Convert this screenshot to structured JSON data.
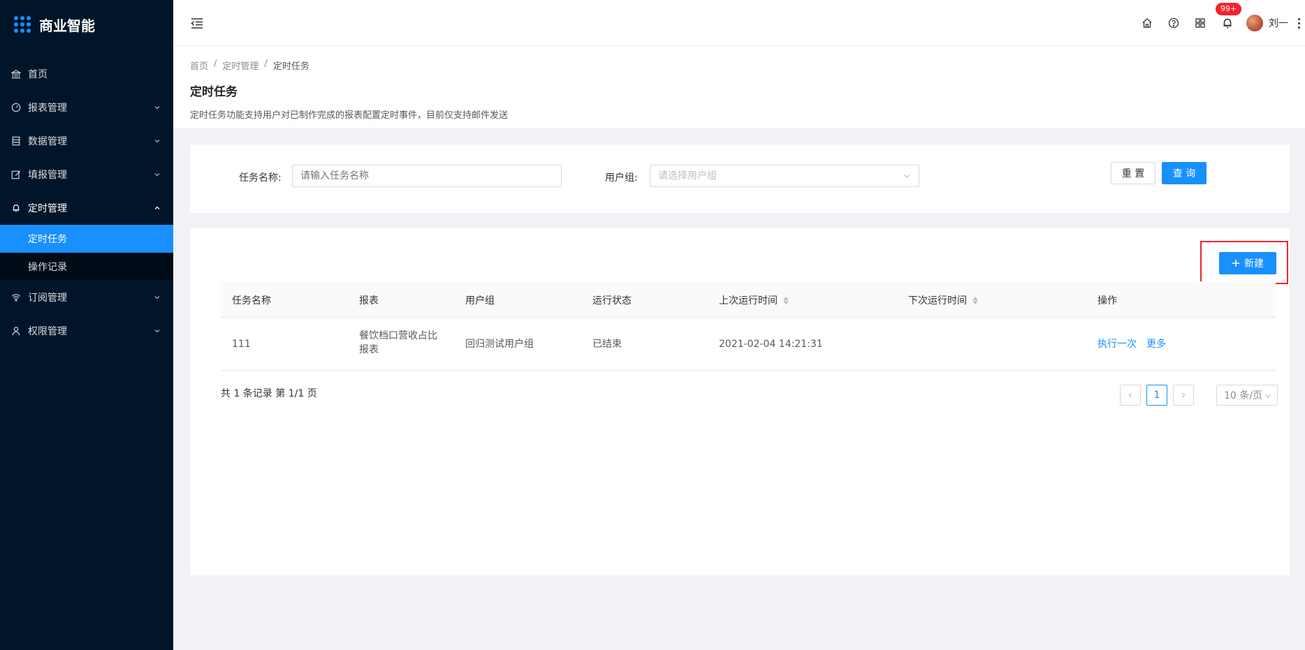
{
  "app": {
    "title": "商业智能"
  },
  "sidebar": {
    "items": [
      {
        "label": "首页",
        "icon": "bank-icon"
      },
      {
        "label": "报表管理",
        "icon": "dashboard-icon"
      },
      {
        "label": "数据管理",
        "icon": "database-icon"
      },
      {
        "label": "填报管理",
        "icon": "edit-icon"
      },
      {
        "label": "定时管理",
        "icon": "bell-icon",
        "expanded": true,
        "children": [
          {
            "label": "定时任务",
            "selected": true
          },
          {
            "label": "操作记录"
          }
        ]
      },
      {
        "label": "订阅管理",
        "icon": "wifi-icon"
      },
      {
        "label": "权限管理",
        "icon": "user-icon"
      }
    ]
  },
  "header": {
    "badge": "99+",
    "user_name": "刘一"
  },
  "breadcrumb": [
    "首页",
    "定时管理",
    "定时任务"
  ],
  "page": {
    "title": "定时任务",
    "description": "定时任务功能支持用户对已制作完成的报表配置定时事件，目前仅支持邮件发送"
  },
  "search": {
    "task_name_label": "任务名称:",
    "task_name_placeholder": "请输入任务名称",
    "user_group_label": "用户组:",
    "user_group_placeholder": "请选择用户组",
    "reset_label": "重 置",
    "query_label": "查 询"
  },
  "table": {
    "new_button_label": "新建",
    "columns": [
      "任务名称",
      "报表",
      "用户组",
      "运行状态",
      "上次运行时间",
      "下次运行时间",
      "操作"
    ],
    "rows": [
      {
        "task_name": "111",
        "report": "餐饮档口营收占比报表",
        "user_group": "回归测试用户组",
        "status": "已结束",
        "last_run": "2021-02-04 14:21:31",
        "next_run": "",
        "actions": [
          "执行一次",
          "更多"
        ]
      }
    ],
    "total_text": "共 1 条记录 第 1/1 页"
  },
  "pagination": {
    "current_page": "1",
    "page_size": "10 条/页"
  },
  "colors": {
    "sidebar_bg": "#001529",
    "primary": "#1890ff",
    "highlight_border": "#f5222d"
  }
}
